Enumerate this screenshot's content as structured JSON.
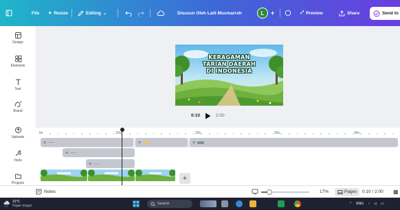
{
  "topbar": {
    "file_label": "File",
    "resize_label": "Resize",
    "editing_label": "Editing",
    "design_title": "Disusun Oleh Laili Musmarroh",
    "user_initial": "L",
    "preview_label": "Preview",
    "share_label": "Share",
    "send_label": "Send to"
  },
  "sidebar": {
    "items": [
      {
        "label": "Design",
        "icon": "layout-icon"
      },
      {
        "label": "Elements",
        "icon": "shapes-icon"
      },
      {
        "label": "Text",
        "icon": "text-icon"
      },
      {
        "label": "Brand",
        "icon": "brand-icon"
      },
      {
        "label": "Uploads",
        "icon": "upload-icon"
      },
      {
        "label": "Tools",
        "icon": "tools-icon"
      },
      {
        "label": "Projects",
        "icon": "folder-icon"
      }
    ]
  },
  "slide": {
    "title_lines": [
      "KERAGAMAN",
      "TARIAN DAERAH",
      "DI INDONESIA"
    ]
  },
  "playback": {
    "current_time": "0:10",
    "total_time": "2:00"
  },
  "timeline": {
    "ticks": [
      "0s",
      "10s",
      "20s",
      "30s",
      "40s"
    ],
    "tracks": [
      {
        "label": "-----"
      },
      {
        "label": "-----"
      },
      {
        "label": "-----"
      }
    ]
  },
  "footer": {
    "notes_label": "Notes",
    "zoom_percent": "17%",
    "zoom_fraction": 0.17,
    "pages_label": "Pages",
    "page_time": "0:10 / 2:00"
  },
  "taskbar": {
    "temperature": "31°C",
    "weather": "Hujan ringan",
    "search_placeholder": "Search",
    "language": "ENG"
  },
  "colors": {
    "topbar_start": "#1fb5c9",
    "topbar_end": "#6a3ee0",
    "avatar": "#2e8b3a",
    "clip": "#c4c7d0",
    "accent": "#7d2ae8"
  }
}
